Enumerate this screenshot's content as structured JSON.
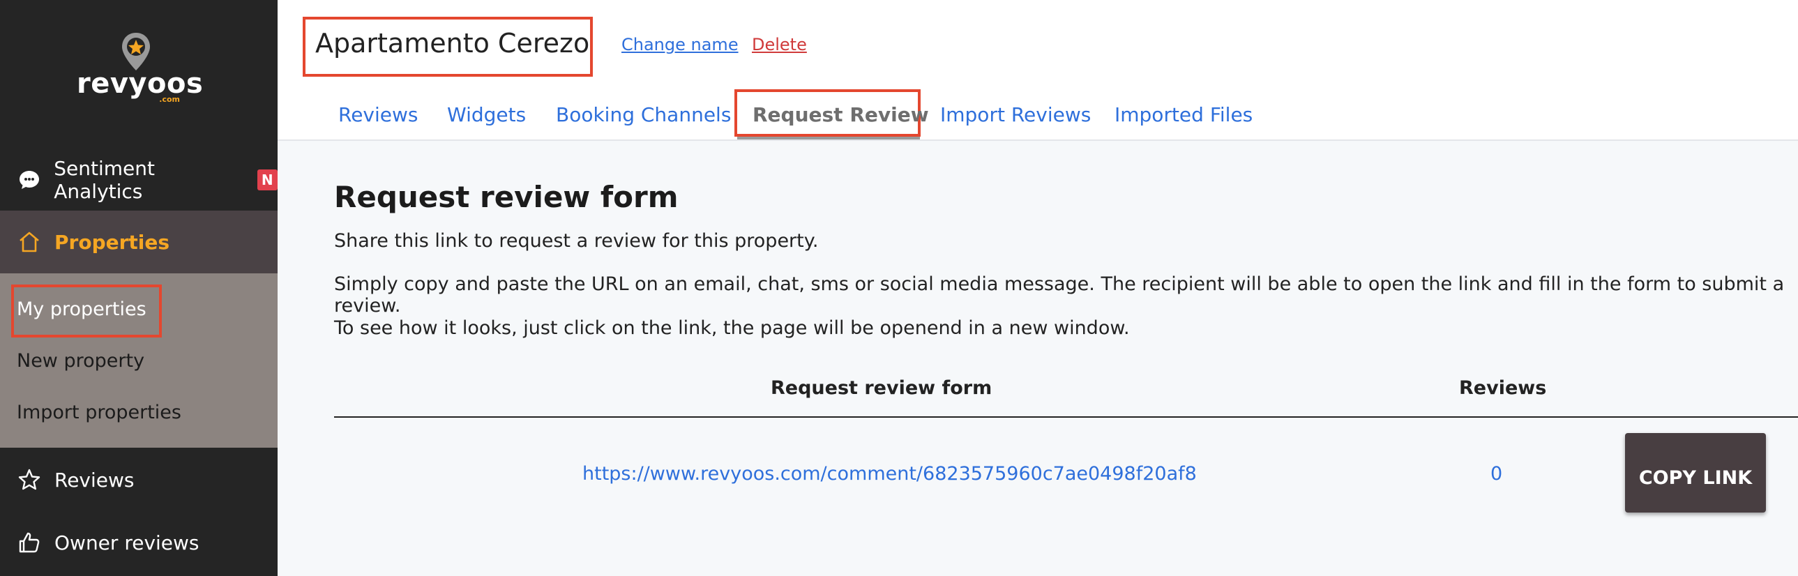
{
  "brand": {
    "name": "revyoos",
    "tld": ".com"
  },
  "sidebar": {
    "sentiment": {
      "label": "Sentiment Analytics",
      "badge": "N"
    },
    "properties": {
      "label": "Properties"
    },
    "submenu": [
      "My properties",
      "New property",
      "Import properties"
    ],
    "reviews": {
      "label": "Reviews"
    },
    "owner_reviews": {
      "label": "Owner reviews"
    }
  },
  "header": {
    "property_name": "Apartamento Cerezo",
    "change_name": "Change name",
    "delete": "Delete"
  },
  "tabs": [
    "Reviews",
    "Widgets",
    "Booking Channels",
    "Request Review",
    "Import Reviews",
    "Imported Files"
  ],
  "active_tab": "Request Review",
  "content": {
    "title": "Request review form",
    "paragraphs": [
      "Share this link to request a review for this property.",
      "Simply copy and paste the URL on an email, chat, sms or social media message. The recipient will be able to open the link and fill in the form to submit a review.",
      "To see how it looks, just click on the link, the page will be openend in a new window."
    ]
  },
  "table": {
    "headers": [
      "Request review form",
      "Reviews"
    ],
    "row": {
      "url": "https://www.revyoos.com/comment/6823575960c7ae0498f20af8",
      "reviews": "0",
      "button": "COPY LINK"
    }
  },
  "colors": {
    "accent": "#f5a623",
    "link": "#2e6fdb",
    "highlight": "#e4472f",
    "sidebar": "#252525"
  }
}
